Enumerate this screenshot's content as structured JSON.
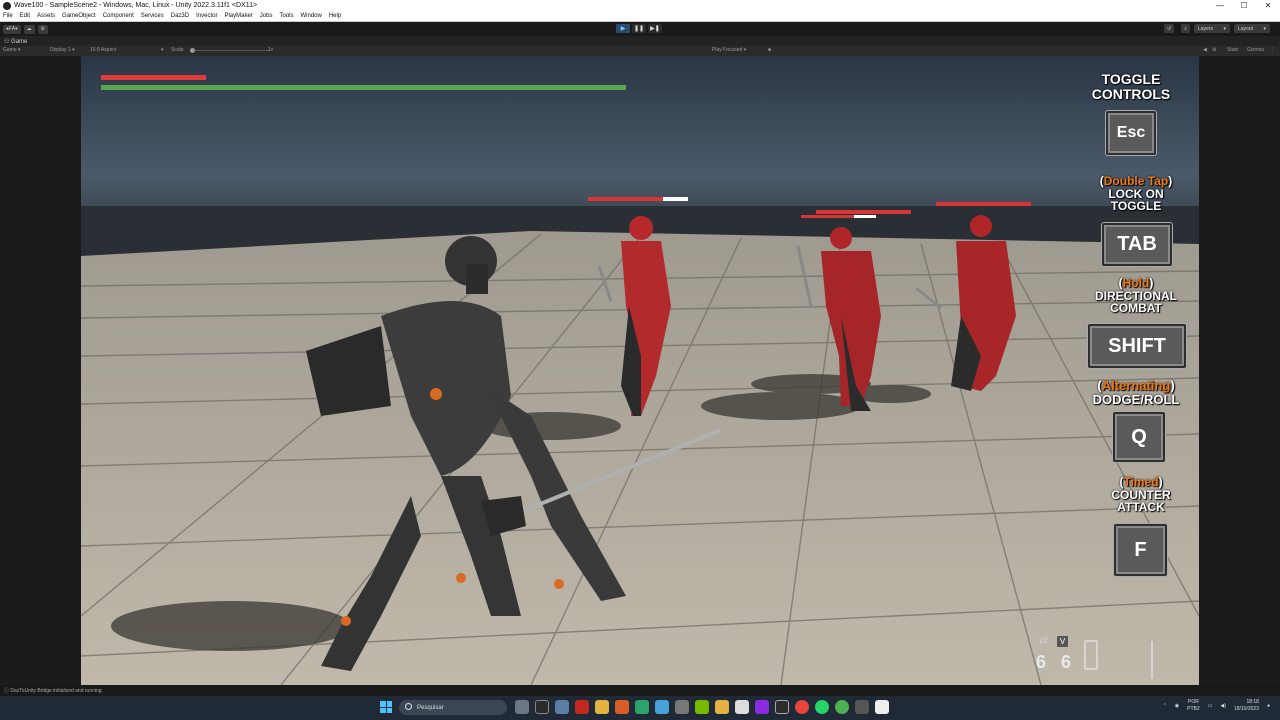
{
  "window": {
    "title": "Wave100 - SampleScene2 - Windows, Mac, Linux - Unity 2022.3.11f1 <DX11>",
    "controls": [
      "—",
      "☐",
      "✕"
    ]
  },
  "menu": [
    "File",
    "Edit",
    "Assets",
    "GameObject",
    "Component",
    "Services",
    "Daz3D",
    "Invector",
    "PlayMaker",
    "Jobs",
    "Tools",
    "Window",
    "Help"
  ],
  "toolbar": {
    "account": "FA",
    "layers": "Layers",
    "layout": "Layout"
  },
  "game_tab": {
    "tab_label": "Game",
    "mode": "Game",
    "display": "Display 1",
    "aspect": "16:9 Aspect",
    "scale_label": "Scale",
    "scale_value": "1x",
    "play_mode": "Play Focused",
    "stats": "Stats",
    "gizmos": "Gizmos"
  },
  "hud": {
    "player_health_fraction": 0.2,
    "player_stamina_fraction": 1.0,
    "colors": {
      "health": "#e03a3a",
      "stamina": "#5aa84e",
      "enemy_health": "#d83636",
      "enemy_lost": "#ffffff"
    }
  },
  "controls": [
    {
      "prefix": "",
      "lines": [
        "TOGGLE",
        "CONTROLS"
      ],
      "key": "Esc"
    },
    {
      "prefix": "Double Tap",
      "lines": [
        "LOCK ON",
        "TOGGLE"
      ],
      "key": "TAB"
    },
    {
      "prefix": "Hold",
      "lines": [
        "DIRECTIONAL",
        "COMBAT"
      ],
      "key": "SHIFT"
    },
    {
      "prefix": "Alternating",
      "lines": [
        "DODGE/ROLL"
      ],
      "key": "Q"
    },
    {
      "prefix": "Timed",
      "lines": [
        "COUNTER",
        "ATTACK"
      ],
      "key": "F"
    }
  ],
  "ammo": {
    "left": "6",
    "right": "6",
    "hint_key": "V"
  },
  "status": "DazToUnity Bridge initialized and running.",
  "taskbar": {
    "search_placeholder": "Pesquisar",
    "lang": "POR",
    "lang_sub": "PTB2",
    "time": "18:18",
    "date": "18/10/2023"
  }
}
